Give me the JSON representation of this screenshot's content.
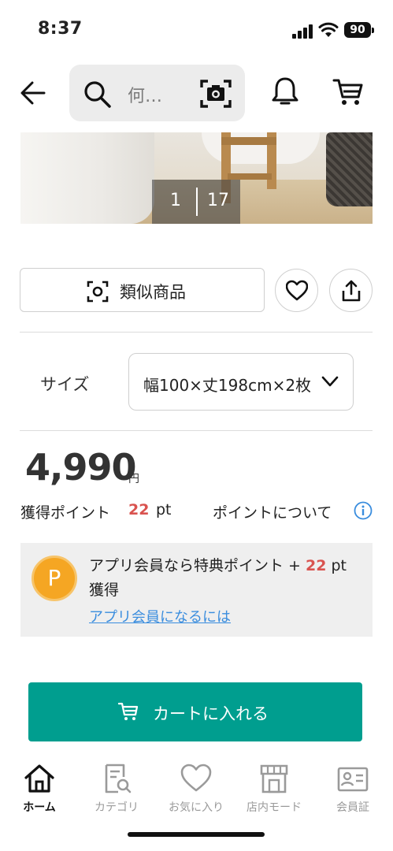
{
  "status": {
    "time": "8:37",
    "battery": "90"
  },
  "header": {
    "search_placeholder": "何…"
  },
  "gallery": {
    "current": "1",
    "total": "17"
  },
  "actions": {
    "similar_label": "類似商品"
  },
  "size": {
    "label": "サイズ",
    "value": "幅100×丈198cm×2枚"
  },
  "price": {
    "amount": "4,990",
    "unit": "円"
  },
  "points": {
    "label": "獲得ポイント",
    "value": "22",
    "unit": "pt",
    "about": "ポイントについて"
  },
  "member": {
    "text_before": "アプリ会員なら特典ポイント + ",
    "value": "22",
    "text_after": " pt 獲得",
    "badge": "P",
    "link": "アプリ会員になるには"
  },
  "cart": {
    "label": "カートに入れる"
  },
  "tabs": [
    {
      "label": "ホーム",
      "icon": "home-icon",
      "active": true
    },
    {
      "label": "カテゴリ",
      "icon": "category-icon",
      "active": false
    },
    {
      "label": "お気に入り",
      "icon": "heart-icon",
      "active": false
    },
    {
      "label": "店内モード",
      "icon": "store-icon",
      "active": false
    },
    {
      "label": "会員証",
      "icon": "member-card-icon",
      "active": false
    }
  ],
  "colors": {
    "accent": "#009e8f",
    "points": "#d9534f",
    "link": "#3a8dde",
    "badge": "#f5a623"
  }
}
